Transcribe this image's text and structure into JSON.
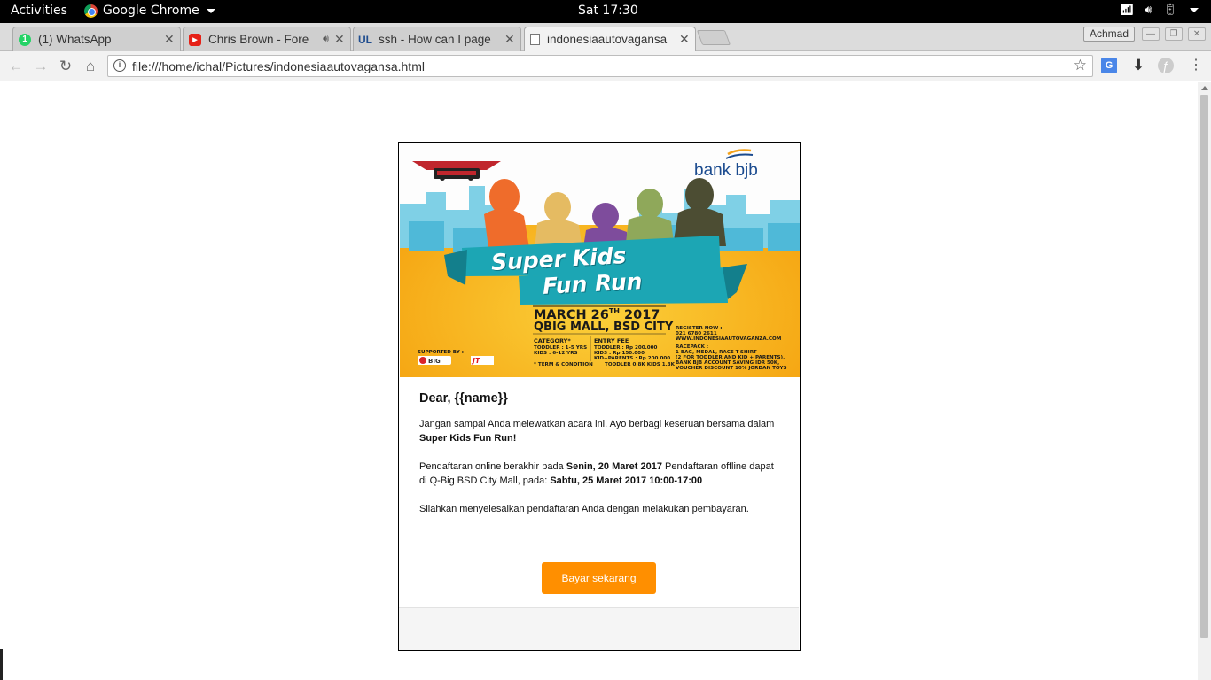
{
  "topbar": {
    "activities": "Activities",
    "app_name": "Google Chrome",
    "clock": "Sat 17:30"
  },
  "tabs": [
    {
      "title": "(1) WhatsApp",
      "icon": "whatsapp-icon"
    },
    {
      "title": "Chris Brown - Fore",
      "icon": "youtube-icon",
      "audio": true
    },
    {
      "title": "ssh - How can I page",
      "icon": "unix-linux-icon"
    },
    {
      "title": "indonesiaautovagansa",
      "icon": "document-icon",
      "active": true
    }
  ],
  "user_badge": "Achmad",
  "address_bar": {
    "url": "file:///home/ichal/Pictures/indonesiaautovagansa.html"
  },
  "banner": {
    "brand": "bank bjb",
    "event_title_line1": "Super Kids",
    "event_title_line2": "Fun Run",
    "date": "MARCH 26",
    "date_suffix": "TH",
    "year": " 2017",
    "venue": "QBIG MALL, BSD CITY",
    "category_header": "CATEGORY*",
    "category_lines": [
      "TODDLER : 1-5 YRS",
      "KIDS         : 6-12 YRS"
    ],
    "fee_header": "ENTRY FEE",
    "fee_lines": [
      "TODDLER            : Rp 200.000",
      "KIDS                    : Rp 150.000",
      "KID+PARENTS   : Rp 200.000"
    ],
    "register_lines": [
      "REGISTER NOW :",
      "021 6780 2611",
      "WWW.INDONESIAAUTOVAGANZA.COM"
    ],
    "racepack_lines": [
      "RACEPACK :",
      "1 BAG, MEDAL, RACE T-SHIRT",
      "(2 FOR TODDLER AND KID + PARENTS),",
      "BANK BJB ACCOUNT SAVING IDR 50K,",
      "VOUCHER DISCOUNT 10% JORDAN TOYS"
    ],
    "supported_by": "SUPPORTED BY :",
    "terms": "* TERM & CONDITION",
    "distance": "TODDLER 0.8K KIDS 1.3K"
  },
  "email": {
    "greeting": "Dear, {{name}}",
    "p1_text": "Jangan sampai Anda melewatkan acara ini. Ayo berbagi keseruan bersama dalam ",
    "p1_bold": "Super Kids Fun Run!",
    "p2_text1": "Pendaftaran online berakhir pada ",
    "p2_bold1": "Senin, 20 Maret 2017",
    "p2_text2": " Pendaftaran offline dapat di Q-Big BSD City Mall, pada: ",
    "p2_bold2": "Sabtu, 25 Maret 2017 10:00-17:00",
    "p3_text": "Silahkan menyelesaikan pendaftaran Anda dengan melakukan pembayaran.",
    "button_label": "Bayar sekarang",
    "button_color": "#ff8f00"
  }
}
